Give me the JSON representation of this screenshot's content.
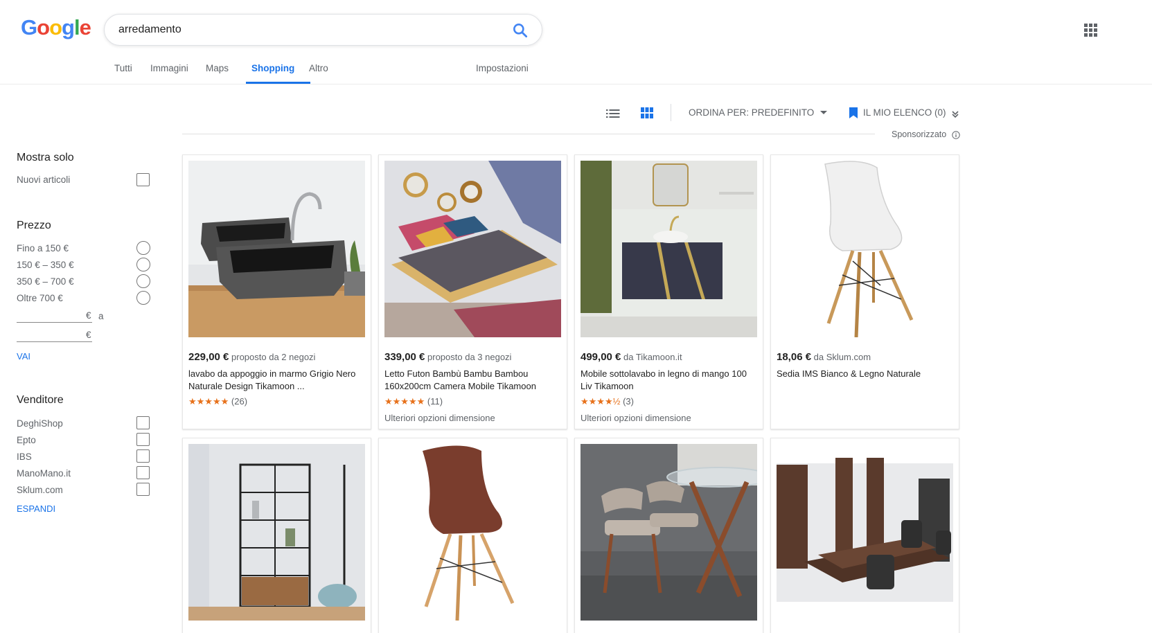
{
  "search": {
    "query": "arredamento"
  },
  "tabs": [
    "Tutti",
    "Immagini",
    "Maps",
    "Shopping",
    "Altro"
  ],
  "settings_label": "Impostazioni",
  "toolbar": {
    "sort_label": "ORDINA PER: PREDEFINITO",
    "mylist_label": "IL MIO ELENCO (0)",
    "sponsored_label": "Sponsorizzato"
  },
  "sidebar": {
    "show_only_heading": "Mostra solo",
    "new_items_label": "Nuovi articoli",
    "price_heading": "Prezzo",
    "price_options": [
      "Fino a 150 €",
      "150 € – 350 €",
      "350 € – 700 €",
      "Oltre 700 €"
    ],
    "euro_symbol": "€",
    "to_label": "a",
    "go_label": "VAI",
    "seller_heading": "Venditore",
    "sellers": [
      "DeghiShop",
      "Epto",
      "IBS",
      "ManoMano.it",
      "Sklum.com"
    ],
    "expand_label": "ESPANDI"
  },
  "products": [
    {
      "price": "229,00 €",
      "source": "proposto da 2 negozi",
      "title": "lavabo da appoggio in marmo Grigio Nero Naturale Design Tikamoon ...",
      "stars": "★★★★★",
      "reviews": "(26)",
      "more": ""
    },
    {
      "price": "339,00 €",
      "source": "proposto da 3 negozi",
      "title": "Letto Futon Bambù Bambu Bambou 160x200cm Camera Mobile Tikamoon",
      "stars": "★★★★★",
      "reviews": "(11)",
      "more": "Ulteriori opzioni dimensione"
    },
    {
      "price": "499,00 €",
      "source": "da Tikamoon.it",
      "title": "Mobile sottolavabo in legno di mango 100 Liv Tikamoon",
      "stars": "★★★★½",
      "reviews": "(3)",
      "more": "Ulteriori opzioni dimensione"
    },
    {
      "price": "18,06 €",
      "source": "da Sklum.com",
      "title": "Sedia IMS Bianco & Legno Naturale",
      "stars": "",
      "reviews": "",
      "more": ""
    }
  ]
}
